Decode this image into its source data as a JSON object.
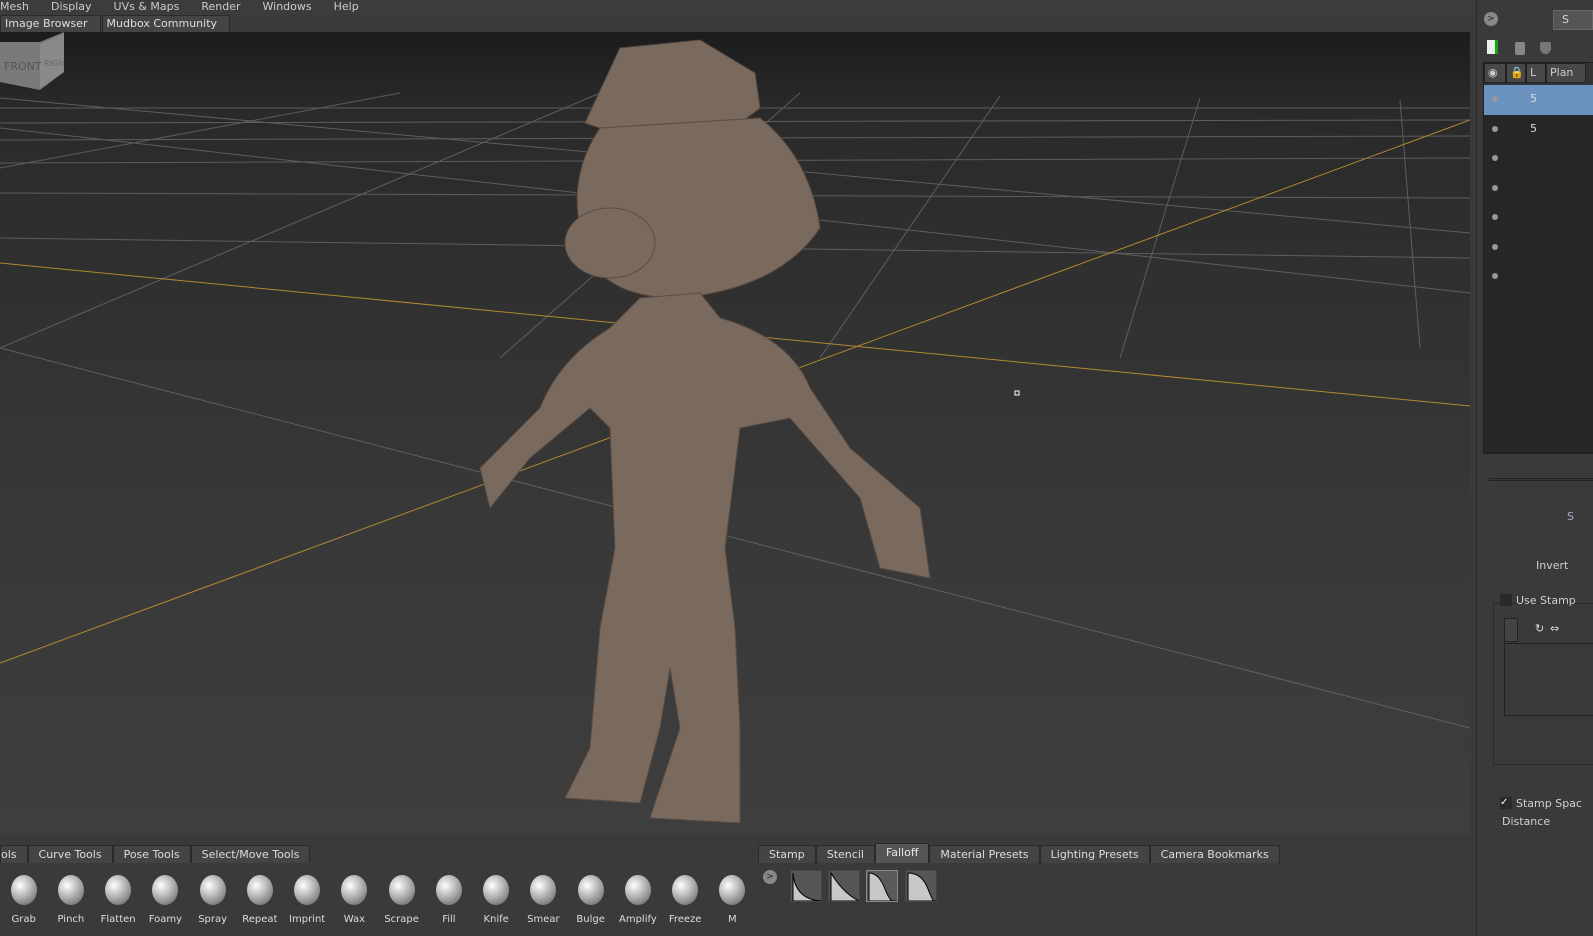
{
  "menu": [
    "Mesh",
    "Display",
    "UVs & Maps",
    "Render",
    "Windows",
    "Help"
  ],
  "top_tabs": [
    "Image Browser",
    "Mudbox Community"
  ],
  "viewcube": {
    "front": "FRONT",
    "right": "RIGHT"
  },
  "layers": {
    "headers": [
      "L",
      "Plan"
    ],
    "rows": [
      {
        "level": "5",
        "selected": true
      },
      {
        "level": "5",
        "selected": false
      },
      {
        "level": ""
      },
      {
        "level": ""
      },
      {
        "level": ""
      },
      {
        "level": ""
      },
      {
        "level": ""
      }
    ]
  },
  "properties": {
    "invert": "Invert",
    "use_stamp": "Use Stamp",
    "stamp_spacing": "Stamp Spac",
    "distance": "Distance",
    "top_btn": "S",
    "label_s": "S"
  },
  "tool_tabs": [
    "ols",
    "Curve Tools",
    "Pose Tools",
    "Select/Move Tools"
  ],
  "tools": [
    "Grab",
    "Pinch",
    "Flatten",
    "Foamy",
    "Spray",
    "Repeat",
    "Imprint",
    "Wax",
    "Scrape",
    "Fill",
    "Knife",
    "Smear",
    "Bulge",
    "Amplify",
    "Freeze",
    "M"
  ],
  "tray_tabs": [
    "Stamp",
    "Stencil",
    "Falloff",
    "Material Presets",
    "Lighting Presets",
    "Camera Bookmarks"
  ],
  "active_tray_tab": "Falloff",
  "colors": {
    "accent": "#6c93bf",
    "model": "#7a6a5e",
    "axis": "#b08a30"
  }
}
